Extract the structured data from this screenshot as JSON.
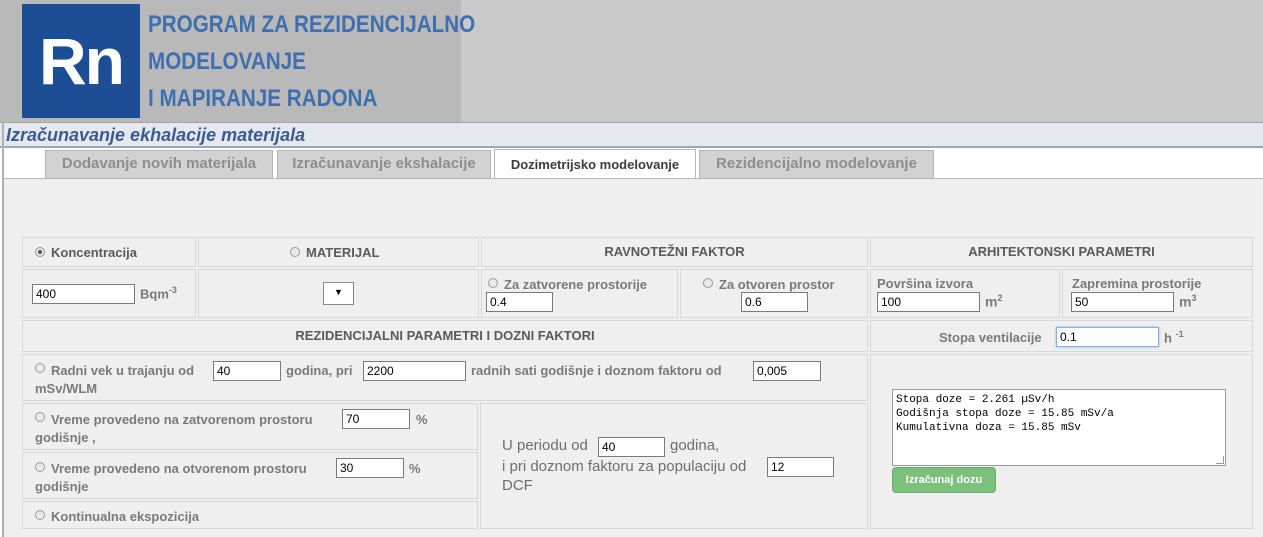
{
  "logo": {
    "letters": "Rn"
  },
  "header": {
    "brand_lines": [
      "PROGRAM ZA REZIDENCIJALNO",
      "MODELOVANJE",
      "I MAPIRANJE RADONA"
    ],
    "page_title": "Izračunavanje ekhalacije materijala"
  },
  "tabs": [
    {
      "label": "Dodavanje novih materijala",
      "active": false
    },
    {
      "label": "Izračunavanje ekshalacije",
      "active": false
    },
    {
      "label": "Dozimetrijsko modelovanje",
      "active": true
    },
    {
      "label": "Rezidencijalno modelovanje",
      "active": false
    }
  ],
  "grid": {
    "koncentracija": {
      "label": "Koncentracija",
      "selected": true,
      "value": "400",
      "unit": "Bqm",
      "unit_exp": "-3"
    },
    "materijal": {
      "label": "MATERIJAL",
      "selected": false,
      "select_value": ""
    },
    "ravnotezni": {
      "header": "RAVNOTEŽNI FAKTOR",
      "zatvoreni_label": "Za zatvorene prostorije",
      "zatvoreni_value": "0.4",
      "otvoreni_label": "Za otvoren prostor",
      "otvoreni_value": "0.6"
    },
    "arhitektonski": {
      "header": "ARHITEKTONSKI PARAMETRI",
      "povrsina_label": "Površina izvora",
      "povrsina_value": "100",
      "povrsina_unit": "m",
      "povrsina_exp": "2",
      "zapremina_label": "Zapremina prostorije",
      "zapremina_value": "50",
      "zapremina_unit": "m",
      "zapremina_exp": "3"
    },
    "rezidencijalni_header": "REZIDENCIJALNI PARAMETRI I DOZNI FAKTORI",
    "ventilacija": {
      "label": "Stopa ventilacije",
      "value": "0.1",
      "unit": "h",
      "unit_exp": "-1"
    },
    "radni_vek": {
      "text1": "Radni vek u trajanju od",
      "value1": "40",
      "text2": "godina, pri",
      "value2": "2200",
      "text3": "radnih sati godišnje i doznom faktoru od",
      "value3": "0,005",
      "text4": "mSv/WLM"
    },
    "zatvoreni_prostor": {
      "text1": "Vreme provedeno na zatvorenom prostoru",
      "value": "70",
      "pct": "%",
      "text2": "godišnje ,"
    },
    "otvoreni_prostor": {
      "text1": "Vreme provedeno na otvorenom prostoru",
      "value": "30",
      "pct": "%",
      "text2": "godišnje"
    },
    "kontinualna": {
      "label": "Kontinualna ekspozicija"
    },
    "period": {
      "text1": "U periodu od",
      "value1": "40",
      "text2": "godina,",
      "text3": "i pri doznom faktoru za populaciju od",
      "value2": "12",
      "text4": "DCF"
    },
    "result_lines": "Stopa doze = 2.261 µSv/h\nGodišnja stopa doze = 15.85 mSv/a\nKumulativna doza = 15.85 mSv",
    "button_label": "Izračunaj dozu"
  },
  "colors": {
    "logo_bg": "#1d4e95",
    "brand_text": "#3f6fb0",
    "button": "#7cc07c",
    "title": "#3b5c8f"
  }
}
